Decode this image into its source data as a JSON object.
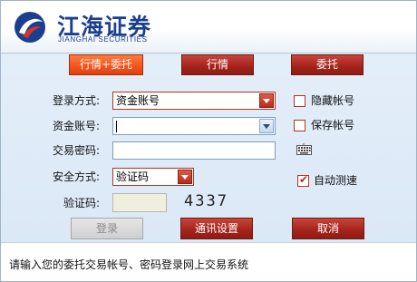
{
  "brand": {
    "name_cn": "江海证券",
    "name_en": "JIANGHAI SECURITIES",
    "logo_icon": "jianghai-logo-icon"
  },
  "tabs": [
    {
      "label": "行情+委托",
      "active": true
    },
    {
      "label": "行情",
      "active": false
    },
    {
      "label": "委托",
      "active": false
    }
  ],
  "form": {
    "login_method": {
      "label": "登录方式:",
      "value": "资金账号"
    },
    "account": {
      "label": "资金账号:",
      "value": ""
    },
    "password": {
      "label": "交易密码:",
      "value": ""
    },
    "security_method": {
      "label": "安全方式:",
      "value": "验证码"
    },
    "captcha": {
      "label": "验证码:",
      "value": "",
      "code": "4337"
    }
  },
  "options": {
    "hide_account": {
      "label": "隐藏帐号",
      "checked": false
    },
    "save_account": {
      "label": "保存帐号",
      "checked": false
    },
    "auto_speed_test": {
      "label": "自动测速",
      "checked": true
    }
  },
  "buttons": {
    "login": "登录",
    "comm_settings": "通讯设置",
    "cancel": "取消"
  },
  "footer": {
    "hint": "请输入您的委托交易帐号、密码登录网上交易系统"
  },
  "colors": {
    "brand_blue": "#1b3f8f",
    "button_red": "#a3231a",
    "active_orange": "#f3521b",
    "panel_bg": "#dde9f5"
  }
}
